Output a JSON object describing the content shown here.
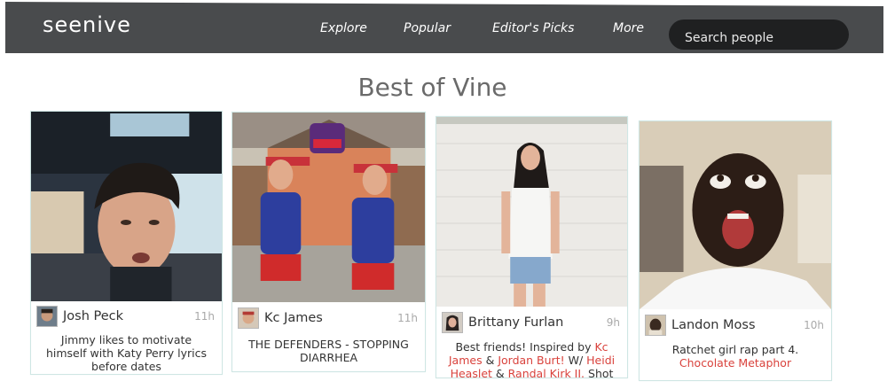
{
  "header": {
    "logo": "seenive",
    "nav": [
      "Explore",
      "Popular",
      "Editor's Picks",
      "More"
    ],
    "search_placeholder": "Search people"
  },
  "page": {
    "title": "Best of Vine"
  },
  "cards": [
    {
      "author": "Josh Peck",
      "age": "11h",
      "caption": [
        "Jimmy likes to motivate",
        "himself with Katy Perry lyrics",
        "before dates"
      ]
    },
    {
      "author": "Kc James",
      "age": "11h",
      "caption": [
        "THE DEFENDERS - STOPPING",
        "DIARRHEA"
      ]
    },
    {
      "author": "Brittany Furlan",
      "age": "9h",
      "caption_line1": "Best friends! Inspired by",
      "link_kc": "Kc",
      "link_james": "James",
      "amp1": "&",
      "link_jordan": "Jordan Burt!",
      "text_w": "W/",
      "link_heidi": "Heidi",
      "link_heaslet": "Heaslet",
      "amp2": "&",
      "link_randal": "Randal Kirk II.",
      "tail": "Shot"
    },
    {
      "author": "Landon Moss",
      "age": "10h",
      "caption_line1": "Ratchet girl rap part 4.",
      "link": "Chocolate Metaphor"
    }
  ],
  "colors": {
    "nav_bg": "#494b4d",
    "search_bg": "#1f2021",
    "link": "#d9423c",
    "card_border": "#cfe6e4"
  }
}
